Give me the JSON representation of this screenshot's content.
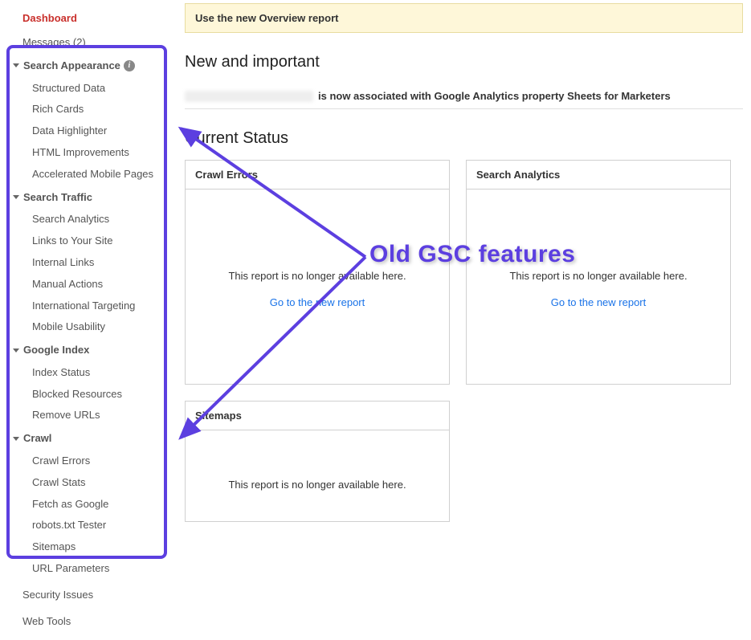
{
  "sidebar": {
    "dashboard": "Dashboard",
    "messages": "Messages (2)",
    "sections": [
      {
        "label": "Search Appearance",
        "hasInfo": true,
        "items": [
          "Structured Data",
          "Rich Cards",
          "Data Highlighter",
          "HTML Improvements",
          "Accelerated Mobile Pages"
        ]
      },
      {
        "label": "Search Traffic",
        "hasInfo": false,
        "items": [
          "Search Analytics",
          "Links to Your Site",
          "Internal Links",
          "Manual Actions",
          "International Targeting",
          "Mobile Usability"
        ]
      },
      {
        "label": "Google Index",
        "hasInfo": false,
        "items": [
          "Index Status",
          "Blocked Resources",
          "Remove URLs"
        ]
      },
      {
        "label": "Crawl",
        "hasInfo": false,
        "items": [
          "Crawl Errors",
          "Crawl Stats",
          "Fetch as Google",
          "robots.txt Tester",
          "Sitemaps",
          "URL Parameters"
        ]
      }
    ],
    "security": "Security Issues",
    "webtools": "Web Tools"
  },
  "banner": "Use the new Overview report",
  "heading_new": "New and important",
  "notice_text": "is now associated with Google Analytics property Sheets for Marketers",
  "heading_status": "Current Status",
  "cards": {
    "crawl_errors": {
      "title": "Crawl Errors",
      "msg": "This report is no longer available here.",
      "link": "Go to the new report"
    },
    "search_analytics": {
      "title": "Search Analytics",
      "msg": "This report is no longer available here.",
      "link": "Go to the new report"
    },
    "sitemaps": {
      "title": "Sitemaps",
      "msg": "This report is no longer available here."
    }
  },
  "annotation": "Old GSC features"
}
